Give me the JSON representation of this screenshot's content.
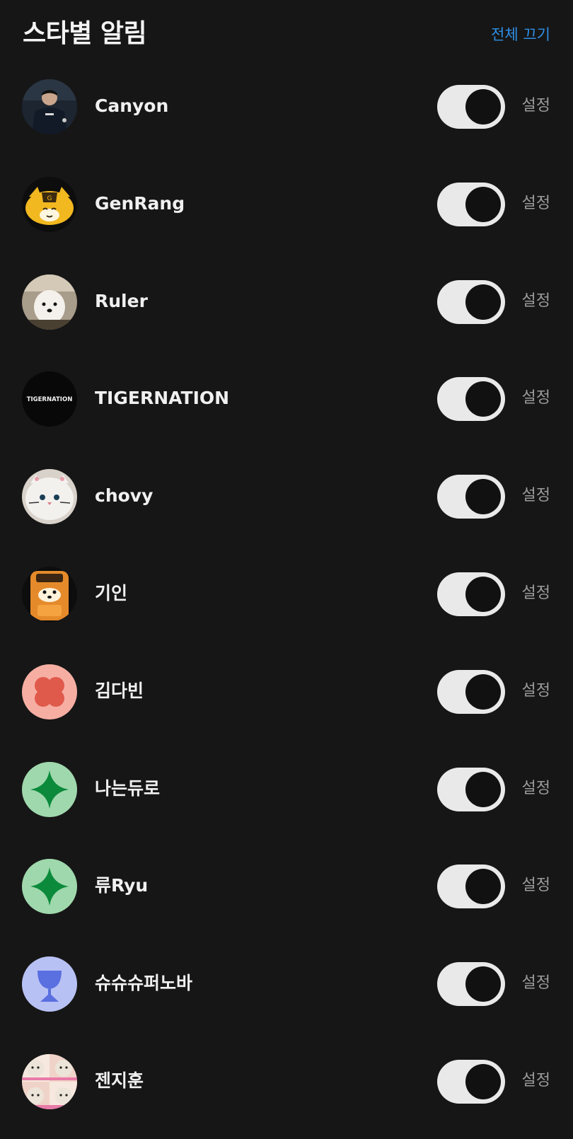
{
  "header": {
    "title": "스타별 알림",
    "turn_off_all_label": "전체 끄기"
  },
  "accent_color": "#2f8fe6",
  "items": [
    {
      "name": "Canyon",
      "toggle_on": true,
      "settings_label": "설정",
      "avatar": "photo-player"
    },
    {
      "name": "GenRang",
      "toggle_on": true,
      "settings_label": "설정",
      "avatar": "tiger-mascot"
    },
    {
      "name": "Ruler",
      "toggle_on": true,
      "settings_label": "설정",
      "avatar": "white-dog"
    },
    {
      "name": "TIGERNATION",
      "toggle_on": true,
      "settings_label": "설정",
      "avatar": "tigernation-logo",
      "avatar_text": "TIGERNATION"
    },
    {
      "name": "chovy",
      "toggle_on": true,
      "settings_label": "설정",
      "avatar": "white-cat-plush"
    },
    {
      "name": "기인",
      "toggle_on": true,
      "settings_label": "설정",
      "avatar": "orange-tiger-plush"
    },
    {
      "name": "김다빈",
      "toggle_on": true,
      "settings_label": "설정",
      "avatar": "red-flower-icon",
      "avatar_bg": "#f6aea3",
      "avatar_fg": "#e05a4b"
    },
    {
      "name": "나는듀로",
      "toggle_on": true,
      "settings_label": "설정",
      "avatar": "green-sparkle-icon",
      "avatar_bg": "#9fd8ad",
      "avatar_fg": "#0c8a3c"
    },
    {
      "name": "류Ryu",
      "toggle_on": true,
      "settings_label": "설정",
      "avatar": "green-sparkle-icon",
      "avatar_bg": "#9fd8ad",
      "avatar_fg": "#0c8a3c"
    },
    {
      "name": "슈슈슈퍼노바",
      "toggle_on": true,
      "settings_label": "설정",
      "avatar": "blue-cup-icon",
      "avatar_bg": "#b8c1f4",
      "avatar_fg": "#5a6fe0"
    },
    {
      "name": "젠지훈",
      "toggle_on": true,
      "settings_label": "설정",
      "avatar": "dog-collage"
    }
  ]
}
